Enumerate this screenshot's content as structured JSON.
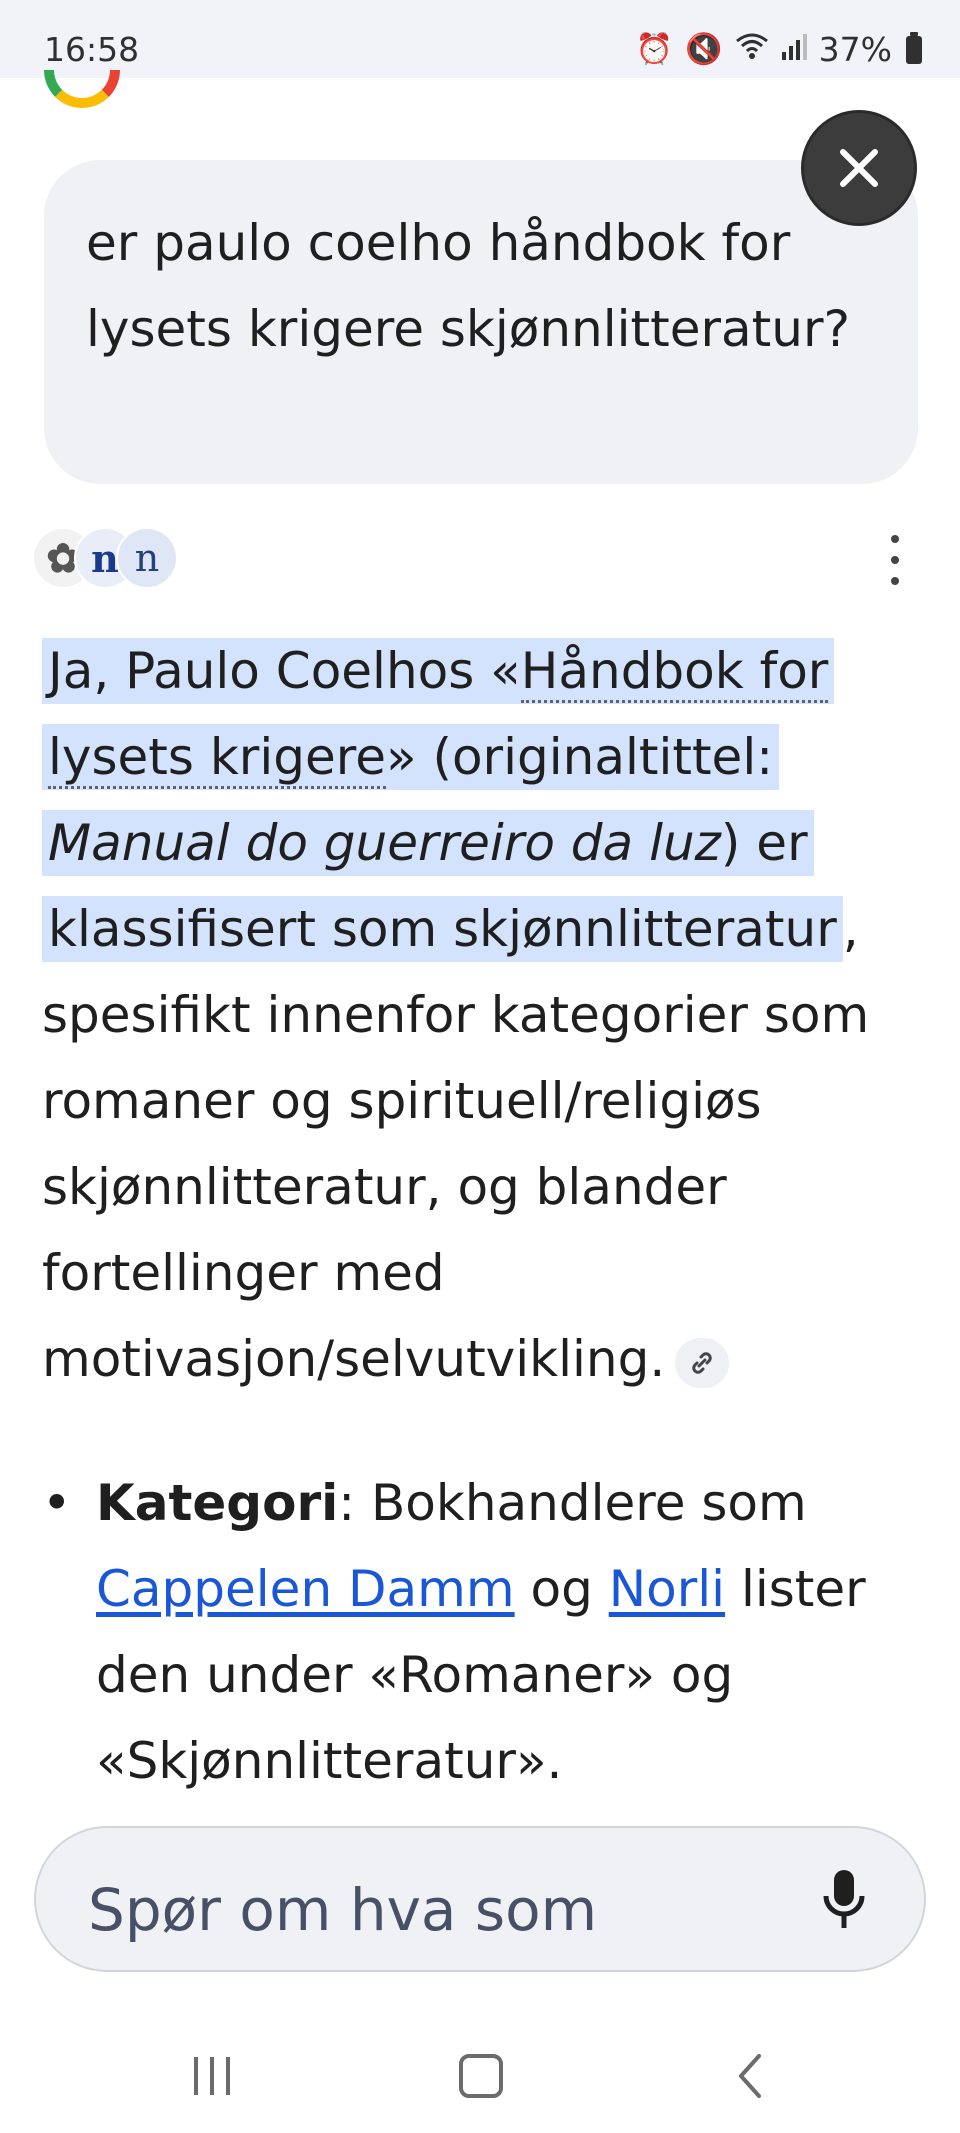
{
  "status_bar": {
    "time": "16:58",
    "battery": "37%",
    "icons": [
      "alarm-icon",
      "mute-icon",
      "wifi-icon",
      "signal-icon",
      "battery-icon"
    ]
  },
  "query": {
    "text": "er paulo coelho håndbok for lysets krigere skjønnlitteratur?"
  },
  "sources": {
    "chips": [
      "✿",
      "n",
      "n"
    ]
  },
  "answer": {
    "part1": "Ja, Paulo Coelhos «",
    "title_link": "Håndbok for lysets krigere",
    "part2": "» (originaltittel: ",
    "original_title": "Manual do guerreiro da luz",
    "part3": ") er klassifisert som skjønnlitteratur",
    "part4": ", spesifikt innenfor kategorier som romaner og spirituell/religiøs skjønnlitteratur, og blander fortellinger med motivasjon/selvutvikling."
  },
  "bullets": [
    {
      "bold": "Kategori",
      "text1": ": Bokhandlere som ",
      "link1": "Cappelen Damm",
      "text2": " og ",
      "link2": "Norli",
      "text3": " lister den under «Romaner» og «Skjønnlitteratur»."
    }
  ],
  "ask_bar": {
    "placeholder": "Spør om hva som"
  },
  "colors": {
    "highlight": "#d3e3fd",
    "link": "#1a57d6",
    "bubble": "#f0f1f5"
  }
}
